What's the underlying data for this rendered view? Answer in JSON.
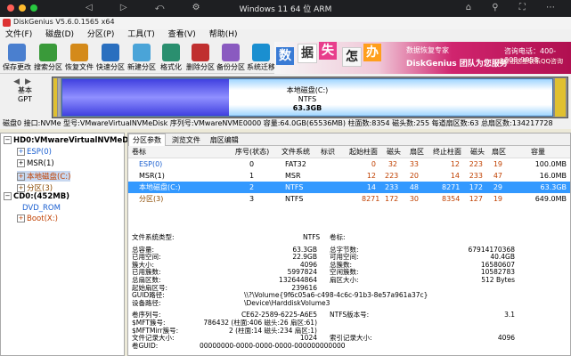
{
  "vm": {
    "title": "Windows 11 64 位 ARM"
  },
  "window": {
    "title": "DiskGenius V5.6.0.1565 x64"
  },
  "menu": [
    "文件(F)",
    "磁盘(D)",
    "分区(P)",
    "工具(T)",
    "查看(V)",
    "帮助(H)"
  ],
  "toolbar": [
    {
      "label": "保存更改",
      "color": "#4a7fcf"
    },
    {
      "label": "搜索分区",
      "color": "#3a9a3a"
    },
    {
      "label": "恢复文件",
      "color": "#d48a1a"
    },
    {
      "label": "快速分区",
      "color": "#2a6fbf"
    },
    {
      "label": "新建分区",
      "color": "#4aa4d8"
    },
    {
      "label": "格式化",
      "color": "#2a8f6f"
    },
    {
      "label": "删除分区",
      "color": "#c03030"
    },
    {
      "label": "备份分区",
      "color": "#8a5ac0"
    },
    {
      "label": "系统迁移",
      "color": "#1a8fd0"
    }
  ],
  "banner": {
    "chars": [
      "数",
      "据",
      "失",
      "怎",
      "办"
    ],
    "line1": "数据恢复专家",
    "line2": "DiskGenius 团队为您服务",
    "phone": "咨询电话：400-008-9958",
    "qq": "或点击这里联系QQ咨询"
  },
  "disk_panel": {
    "basic": "基本",
    "gpt": "GPT"
  },
  "disk_map": {
    "label": "本地磁盘(C:)",
    "fs": "NTFS",
    "size": "63.3GB",
    "used_fraction": 0.34
  },
  "disk_info": "磁盘0 接口:NVMe  型号:VMwareVirtualNVMeDisk  序列号:VMwareNVME0000  容量:64.0GB(65536MB)  柱面数:8354  磁头数:255  每道扇区数:63  总扇区数:134217728",
  "tree": {
    "disk": "HD0:VMwareVirtualNVMeDisk",
    "parts": [
      "ESP(0)",
      "MSR(1)",
      "本地磁盘(C:)",
      "分区(3)"
    ],
    "cd": "CD0:(452MB)",
    "dvd": "DVD_ROM",
    "boot": "Boot(X:)"
  },
  "tabs": [
    "分区参数",
    "浏览文件",
    "扇区编辑"
  ],
  "table": {
    "headers": [
      "卷标",
      "序号(状态)",
      "文件系统",
      "标识",
      "起始柱面",
      "磁头",
      "扇区",
      "终止柱面",
      "磁头",
      "扇区",
      "容量"
    ],
    "rows": [
      [
        "ESP(0)",
        "0",
        "FAT32",
        "",
        "0",
        "32",
        "33",
        "12",
        "223",
        "19",
        "100.0MB"
      ],
      [
        "MSR(1)",
        "1",
        "MSR",
        "",
        "12",
        "223",
        "20",
        "14",
        "233",
        "47",
        "16.0MB"
      ],
      [
        "本地磁盘(C:)",
        "2",
        "NTFS",
        "",
        "14",
        "233",
        "48",
        "8271",
        "172",
        "29",
        "63.3GB"
      ],
      [
        "分区(3)",
        "3",
        "NTFS",
        "",
        "8271",
        "172",
        "30",
        "8354",
        "127",
        "19",
        "649.0MB"
      ]
    ]
  },
  "fsinfo": {
    "type_label": "文件系统类型:",
    "type_value": "NTFS",
    "vol_label": "卷标:",
    "rows": [
      [
        "总容量:",
        "63.3GB",
        "总字节数:",
        "67914170368"
      ],
      [
        "已用空间:",
        "22.9GB",
        "可用空间:",
        "40.4GB"
      ],
      [
        "簇大小:",
        "4096",
        "总簇数:",
        "16580607"
      ],
      [
        "已用簇数:",
        "5997824",
        "空闲簇数:",
        "10582783"
      ],
      [
        "总扇区数:",
        "132644864",
        "扇区大小:",
        "512 Bytes"
      ],
      [
        "起始扇区号:",
        "239616",
        "",
        ""
      ]
    ],
    "guid_path_label": "GUID路径:",
    "guid_path": "\\\\?\\Volume{9f6c05a6-c498-4c6c-91b3-8e57a961a37c}",
    "device_path_label": "设备路径:",
    "device_path": "\\Device\\HarddiskVolume3",
    "rows2": [
      [
        "卷序列号:",
        "CE62-2589-6225-A6E5",
        "NTFS版本号:",
        "3.1"
      ],
      [
        "$MFT簇号:",
        "786432 (柱面:406 磁头:26 扇区:61)",
        "",
        ""
      ],
      [
        "$MFTMirr簇号:",
        "2 (柱面:14 磁头:234 扇区:1)",
        "",
        ""
      ],
      [
        "文件记录大小:",
        "1024",
        "索引记录大小:",
        "4096"
      ]
    ],
    "guid_label": "卷GUID:",
    "guid": "00000000-0000-0000-0000-000000000000"
  }
}
